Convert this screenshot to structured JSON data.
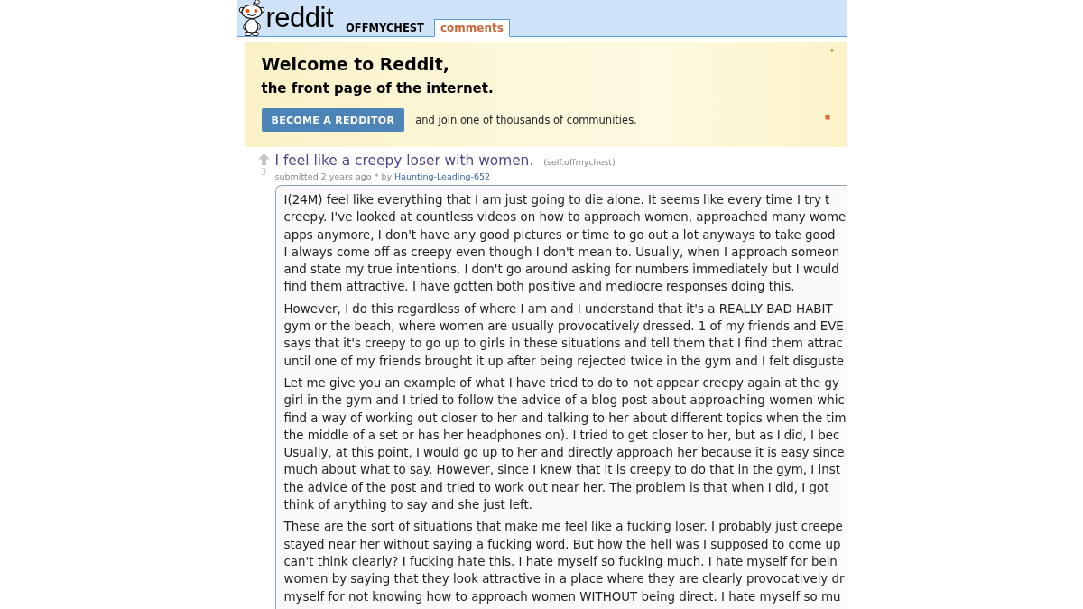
{
  "header": {
    "logo_text": "reddit",
    "subreddit": "OFFMYCHEST",
    "tabs": [
      {
        "label": "comments",
        "selected": true
      }
    ]
  },
  "welcome_banner": {
    "title": "Welcome to Reddit,",
    "subtitle": "the front page of the internet.",
    "button": "BECOME A REDDITOR",
    "tagline": "and join one of thousands of communities."
  },
  "post": {
    "score": "3",
    "title": "I feel like a creepy loser with women.",
    "domain": "(self.offmychest)",
    "submitted": "submitted 2 years ago * by",
    "author": "Haunting-Leading-652",
    "paragraphs": [
      {
        "lines": [
          "I(24M) feel like everything that I am just going to die alone. It seems like every time I try t",
          "creepy. I've looked at countless videos on how to approach women, approached many wome",
          "apps anymore, I don't have any good pictures or time to go out a lot anyways to take good",
          "I always come off as creepy even though I don't mean to. Usually, when I approach someon",
          "and state my true intentions. I don't go around asking for numbers immediately but I would",
          "find them attractive. I have gotten both positive and mediocre responses doing this."
        ]
      },
      {
        "lines": [
          "However, I do this regardless of where I am and I understand that it's a REALLY BAD HABIT",
          "gym or the beach, where women are usually provocatively dressed. 1 of my friends and EVE",
          "says that it's creepy to go up to girls in these situations and tell them that I find them attrac",
          "until one of my friends brought it up after being rejected twice in the gym and I felt disguste"
        ]
      },
      {
        "lines": [
          "Let me give you an example of what I have tried to do to not appear creepy again at the gy",
          "girl in the gym and I tried to follow the advice of a blog post about approaching women whic",
          "find a way of working out closer to her and talking to her about different topics when the tim",
          "the middle of a set or has her headphones on). I tried to get closer to her, but as I did, I bec",
          "Usually, at this point, I would go up to her and directly approach her because it is easy since",
          "much about what to say. However, since I knew that it is creepy to do that in the gym, I inst",
          "the advice of the post and tried to work out near her. The problem is that when I did, I got",
          "think of anything to say and she just left."
        ]
      },
      {
        "lines": [
          "These are the sort of situations that make me feel like a fucking loser. I probably just creepe",
          "stayed near her without saying a fucking word. But how the hell was I supposed to come up",
          "can't think clearly? I fucking hate this. I hate myself so fucking much. I hate myself for bein",
          "women by saying that they look attractive in a place where they are clearly provocatively dr",
          "myself for not knowing how to approach women WITHOUT being direct. I hate myself so mu"
        ]
      }
    ]
  }
}
